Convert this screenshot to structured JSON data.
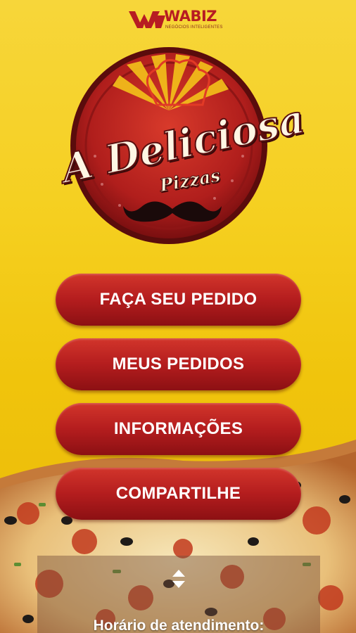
{
  "brand": {
    "name": "WABIZ",
    "tagline": "NEGÓCIOS INTELIGENTES"
  },
  "logo": {
    "title": "A Deliciosa",
    "subtitle": "Pizzas"
  },
  "menu": {
    "order_label": "FAÇA SEU PEDIDO",
    "my_orders_label": "MEUS PEDIDOS",
    "info_label": "INFORMAÇÕES",
    "share_label": "COMPARTILHE"
  },
  "hours": {
    "title": "Horário de atendimento:"
  },
  "colors": {
    "background_top": "#f7d63a",
    "background_bottom": "#e9b808",
    "button_red": "#b41d1e",
    "brand_red": "#b71c22"
  },
  "icons": {
    "brand": "wabiz-logo-icon",
    "toggle": "expand-toggle-icon"
  }
}
